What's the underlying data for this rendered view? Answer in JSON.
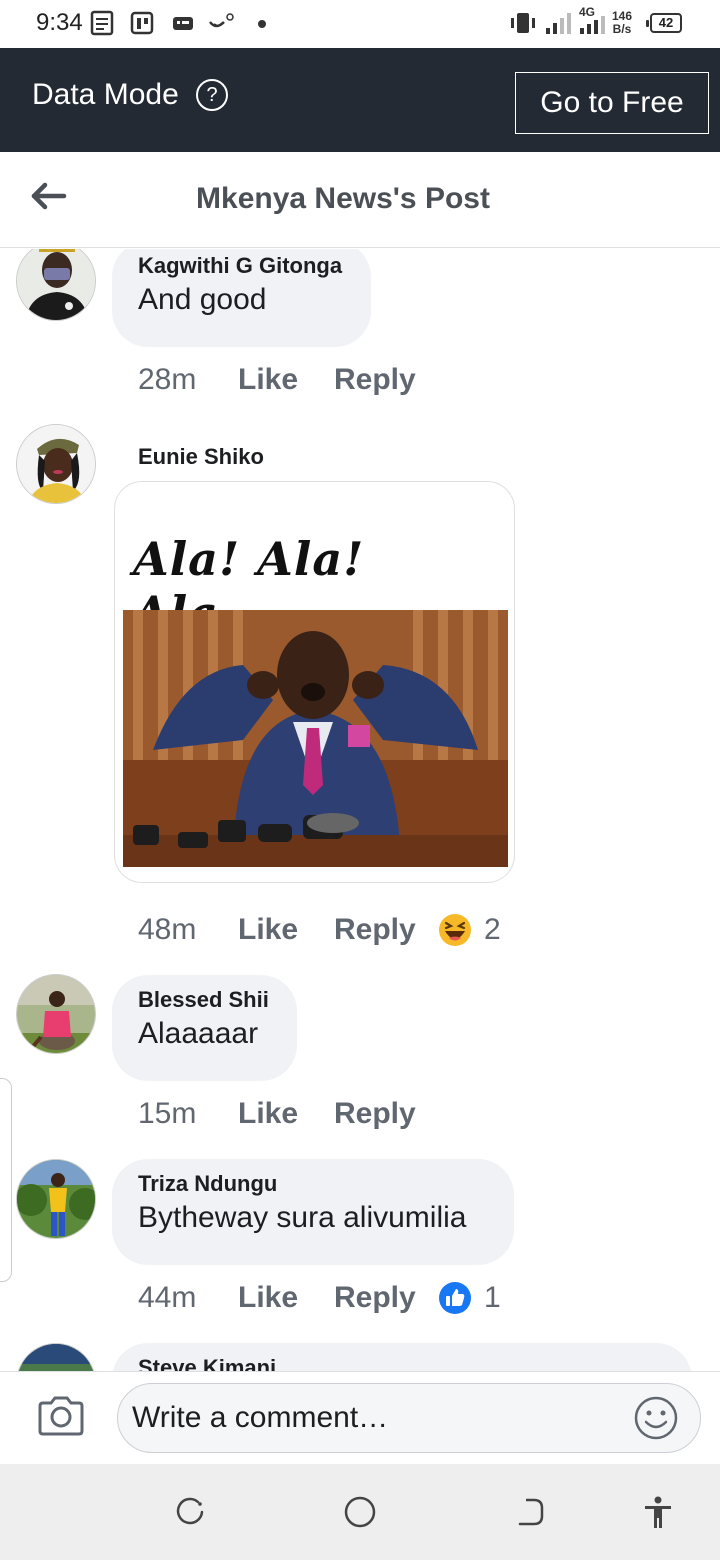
{
  "status_bar": {
    "time": "9:34",
    "network": "4G",
    "speed_value": "146",
    "speed_unit": "B/s",
    "battery": "42"
  },
  "banner": {
    "data_mode_label": "Data Mode",
    "help_icon": "?",
    "go_free_label": "Go to Free"
  },
  "header": {
    "title": "Mkenya News's Post"
  },
  "comments": [
    {
      "author": "Kagwithi G Gitonga",
      "text": "And good",
      "time": "28m",
      "like": "Like",
      "reply": "Reply"
    },
    {
      "author": "Eunie Shiko",
      "image_caption": "Ala! Ala! Ala...",
      "time": "48m",
      "like": "Like",
      "reply": "Reply",
      "reaction": "laughing-emoji",
      "reaction_count": "2"
    },
    {
      "author": "Blessed Shii",
      "text": "Alaaaaar",
      "time": "15m",
      "like": "Like",
      "reply": "Reply"
    },
    {
      "author": "Triza Ndungu",
      "text": "Bytheway sura alivumilia",
      "time": "44m",
      "like": "Like",
      "reply": "Reply",
      "reaction": "thumbs-up",
      "reaction_count": "1"
    },
    {
      "author": "Steve Kimani"
    }
  ],
  "composer": {
    "placeholder": "Write a comment…"
  },
  "colors": {
    "banner_bg": "#232a33",
    "bubble_bg": "#f0f2f5",
    "like_blue": "#1877f2",
    "meta_gray": "#606770"
  }
}
